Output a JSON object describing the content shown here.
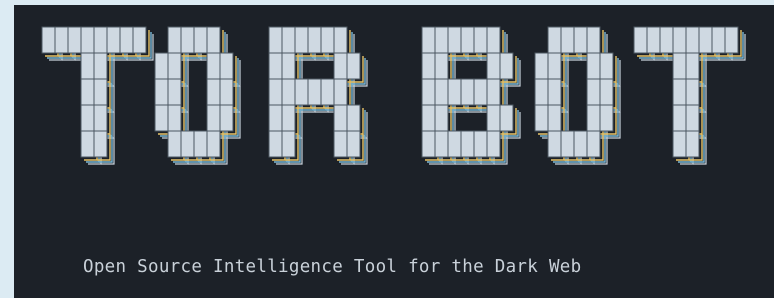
{
  "terminal": {
    "banner_text": "TOR BOT",
    "tagline": "Open Source Intelligence Tool for the Dark Web"
  },
  "colors": {
    "terminal_bg": "#1c2128",
    "page_bg": "#dcebf3",
    "block_fill": "#cfd9e2",
    "shadow_yellow": "#e8c468",
    "shadow_blue": "#79b8d6",
    "text": "#c9d1d9"
  }
}
